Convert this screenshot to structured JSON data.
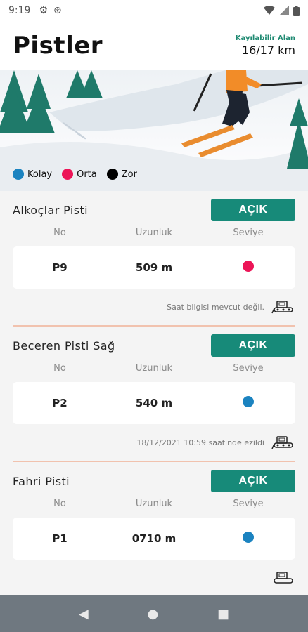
{
  "status_bar": {
    "time": "9:19"
  },
  "header": {
    "title": "Pistler",
    "capacity_label": "Kayılabilir Alan",
    "capacity_value": "16/17 km"
  },
  "legend": [
    {
      "label": "Kolay",
      "color": "#1b83c0"
    },
    {
      "label": "Orta",
      "color": "#ec1557"
    },
    {
      "label": "Zor",
      "color": "#000000"
    }
  ],
  "columns": {
    "no": "No",
    "length": "Uzunluk",
    "level": "Seviye"
  },
  "pistes": [
    {
      "name": "Alkoçlar Pisti",
      "status": "AÇIK",
      "no": "P9",
      "length": "509 m",
      "level_color": "#ec1557",
      "grooming": "Saat bilgisi mevcut değil."
    },
    {
      "name": "Beceren Pisti Sağ",
      "status": "AÇIK",
      "no": "P2",
      "length": "540 m",
      "level_color": "#1b83c0",
      "grooming": "18/12/2021 10:59 saatinde ezildi"
    },
    {
      "name": "Fahri Pisti",
      "status": "AÇIK",
      "no": "P1",
      "length": "0710 m",
      "level_color": "#1b83c0",
      "grooming": ""
    }
  ],
  "nav": {
    "back_icon": "back-triangle-icon",
    "home_icon": "home-circle-icon",
    "recents_icon": "recents-square-icon"
  }
}
